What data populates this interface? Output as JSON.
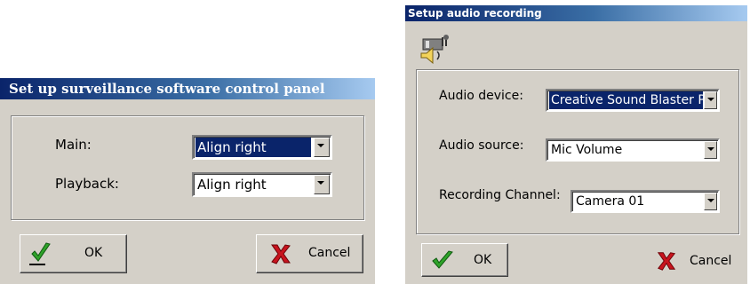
{
  "dialog1": {
    "title": "Set up surveillance software control panel",
    "main_label": "Main:",
    "main_value": "Align right",
    "playback_label": "Playback:",
    "playback_value": "Align right",
    "ok_label": "OK",
    "cancel_label": "Cancel"
  },
  "dialog2": {
    "title": "Setup audio recording",
    "audio_device_label": "Audio device:",
    "audio_device_value": "Creative Sound Blaster PCI",
    "audio_source_label": "Audio source:",
    "audio_source_value": "Mic Volume",
    "channel_label": "Recording Channel:",
    "channel_value": "Camera 01",
    "ok_label": "OK",
    "cancel_label": "Cancel"
  },
  "icons": {
    "check": "check-icon",
    "cross": "cross-icon",
    "audio": "microphone-speaker-icon"
  },
  "colors": {
    "titlebar_start": "#0a246a",
    "titlebar_end": "#a6caf0",
    "selection": "#0a246a",
    "dialog_bg": "#d4d0c8",
    "check_green": "#2fa32a",
    "cross_red": "#c8141e"
  }
}
